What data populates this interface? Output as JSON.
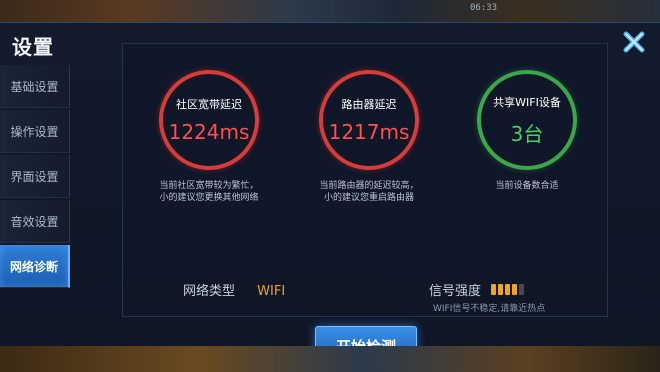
{
  "top_bar": {
    "clock": "06:33"
  },
  "title": "设置",
  "sidebar": {
    "tabs": [
      {
        "label": "基础设置",
        "active": false
      },
      {
        "label": "操作设置",
        "active": false
      },
      {
        "label": "界面设置",
        "active": false
      },
      {
        "label": "音效设置",
        "active": false
      },
      {
        "label": "网络诊断",
        "active": true
      }
    ]
  },
  "gauges": [
    {
      "label": "社区宽带延迟",
      "value": "1224ms",
      "status": "red",
      "note_line1": "当前社区宽带较为繁忙，",
      "note_line2": "小的建议您更换其他网络"
    },
    {
      "label": "路由器延迟",
      "value": "1217ms",
      "status": "red",
      "note_line1": "当前路由器的延迟较高，",
      "note_line2": "小的建议您重启路由器"
    },
    {
      "label": "共享WIFI设备",
      "value": "3台",
      "status": "green",
      "note_line1": "当前设备数合适",
      "note_line2": ""
    }
  ],
  "network": {
    "type_label": "网络类型",
    "type_value": "WIFI",
    "signal_label": "信号强度",
    "signal_level": 4,
    "signal_max": 5,
    "signal_note": "WIFI信号不稳定,请靠近热点"
  },
  "start_button": "开始检测",
  "colors": {
    "red": "#d93a3a",
    "green": "#3aa84a",
    "accent": "#2f7fd6",
    "wifi": "#f0a020"
  }
}
